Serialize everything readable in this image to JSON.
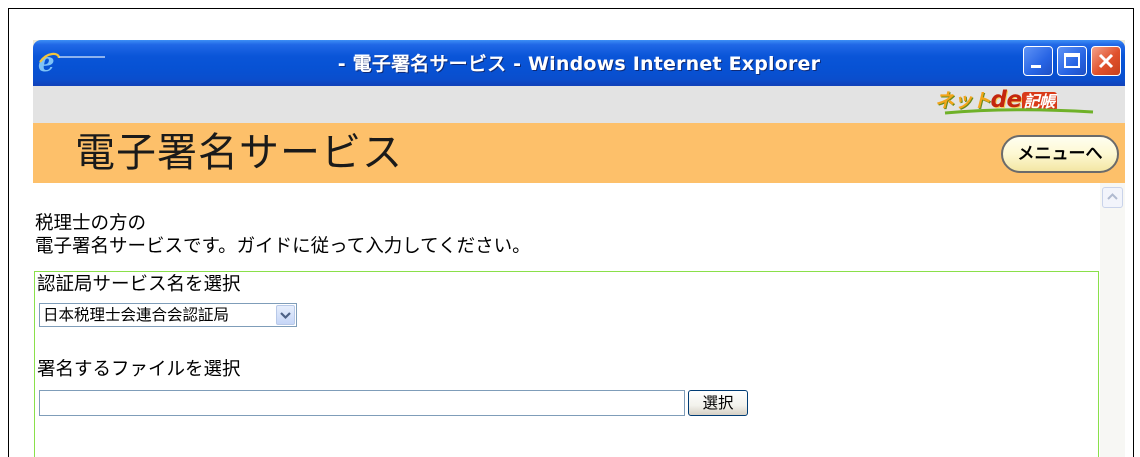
{
  "window": {
    "title": "- 電子署名サービス - Windows Internet Explorer",
    "icon": "ie-logo-icon",
    "controls": [
      "minimize-icon",
      "maximize-icon",
      "close-icon"
    ]
  },
  "brand": {
    "part_a": "ネット",
    "part_b": "de",
    "part_c": "記帳"
  },
  "header": {
    "title": "電子署名サービス",
    "menu_button": "メニューへ"
  },
  "intro": {
    "line1": "税理士の方の",
    "line2": "電子署名サービスです。ガイドに従って入力してください。"
  },
  "form": {
    "ca_label": "認証局サービス名を選択",
    "ca_selected": "日本税理士会連合会認証局",
    "file_label": "署名するファイルを選択",
    "file_value": "",
    "browse_button": "選択"
  },
  "colors": {
    "titlebar": "#0a55d8",
    "header_band": "#fdc06a",
    "form_border": "#8ae04a"
  }
}
